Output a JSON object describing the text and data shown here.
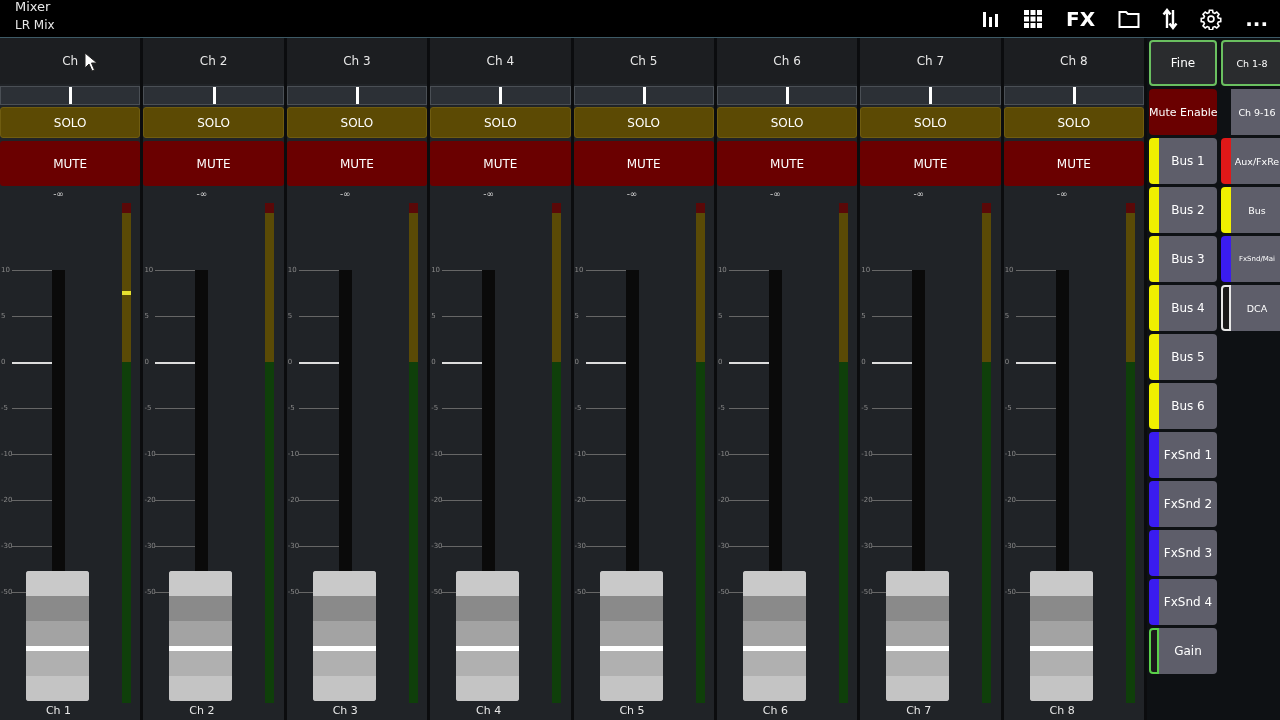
{
  "header": {
    "title": "Mixer",
    "subtitle": "LR Mix",
    "tools": [
      {
        "kind": "bars"
      },
      {
        "kind": "grid"
      },
      {
        "kind": "text",
        "label": "FX"
      },
      {
        "kind": "folder"
      },
      {
        "kind": "arrows"
      },
      {
        "kind": "gear"
      },
      {
        "kind": "text",
        "label": "..."
      }
    ]
  },
  "channels": [
    {
      "name": "Ch",
      "pan": {
        "level": 0.5
      },
      "solo": "SOLO",
      "mute": "MUTE",
      "gain_reading": "-∞",
      "fader": {
        "level": 0.12
      },
      "meter": {
        "level": 0.82
      },
      "label": "Ch 1",
      "scale": [
        "10",
        "5",
        "0",
        "-5",
        "-10",
        "-20",
        "-30",
        "-50"
      ]
    },
    {
      "name": "Ch 2",
      "pan": {
        "level": 0.5
      },
      "solo": "SOLO",
      "mute": "MUTE",
      "gain_reading": "-∞",
      "fader": {
        "level": 0.12
      },
      "label": "Ch 2",
      "scale": [
        "10",
        "5",
        "0",
        "-5",
        "-10",
        "-20",
        "-30",
        "-50"
      ]
    },
    {
      "name": "Ch 3",
      "pan": {
        "level": 0.5
      },
      "solo": "SOLO",
      "mute": "MUTE",
      "gain_reading": "-∞",
      "fader": {
        "level": 0.12
      },
      "label": "Ch 3",
      "scale": [
        "10",
        "5",
        "0",
        "-5",
        "-10",
        "-20",
        "-30",
        "-50"
      ]
    },
    {
      "name": "Ch 4",
      "pan": {
        "level": 0.5
      },
      "solo": "SOLO",
      "mute": "MUTE",
      "gain_reading": "-∞",
      "fader": {
        "level": 0.12
      },
      "label": "Ch 4",
      "scale": [
        "10",
        "5",
        "0",
        "-5",
        "-10",
        "-20",
        "-30",
        "-50"
      ]
    },
    {
      "name": "Ch 5",
      "pan": {
        "level": 0.5
      },
      "solo": "SOLO",
      "mute": "MUTE",
      "gain_reading": "-∞",
      "fader": {
        "level": 0.12
      },
      "label": "Ch 5",
      "scale": [
        "10",
        "5",
        "0",
        "-5",
        "-10",
        "-20",
        "-30",
        "-50"
      ]
    },
    {
      "name": "Ch 6",
      "pan": {
        "level": 0.5
      },
      "solo": "SOLO",
      "mute": "MUTE",
      "gain_reading": "-∞",
      "fader": {
        "level": 0.12
      },
      "label": "Ch 6",
      "scale": [
        "10",
        "5",
        "0",
        "-5",
        "-10",
        "-20",
        "-30",
        "-50"
      ]
    },
    {
      "name": "Ch 7",
      "pan": {
        "level": 0.5
      },
      "solo": "SOLO",
      "mute": "MUTE",
      "gain_reading": "-∞",
      "fader": {
        "level": 0.12
      },
      "label": "Ch 7",
      "scale": [
        "10",
        "5",
        "0",
        "-5",
        "-10",
        "-20",
        "-30",
        "-50"
      ]
    },
    {
      "name": "Ch 8",
      "pan": {
        "level": 0.5
      },
      "solo": "SOLO",
      "mute": "MUTE",
      "gain_reading": "-∞",
      "fader": {
        "level": 0.12
      },
      "label": "Ch 8",
      "scale": [
        "10",
        "5",
        "0",
        "-5",
        "-10",
        "-20",
        "-30",
        "-50"
      ]
    }
  ],
  "side_controls": [
    {
      "kind": "toggle",
      "label": "Fine",
      "selected": true
    },
    {
      "kind": "mute",
      "label": "Mute Enable"
    },
    {
      "kind": "stripe",
      "label": "Bus 1",
      "color": "#f0f000"
    },
    {
      "kind": "stripe",
      "label": "Bus 2",
      "color": "#f0f000"
    },
    {
      "kind": "stripe",
      "label": "Bus 3",
      "color": "#f0f000"
    },
    {
      "kind": "stripe",
      "label": "Bus 4",
      "color": "#f0f000"
    },
    {
      "kind": "stripe",
      "label": "Bus 5",
      "color": "#f0f000"
    },
    {
      "kind": "stripe",
      "label": "Bus 6",
      "color": "#f0f000"
    },
    {
      "kind": "stripe",
      "label": "FxSnd 1",
      "color": "#3a1cf0"
    },
    {
      "kind": "stripe",
      "label": "FxSnd 2",
      "color": "#3a1cf0"
    },
    {
      "kind": "stripe",
      "label": "FxSnd 3",
      "color": "#3a1cf0"
    },
    {
      "kind": "stripe",
      "label": "FxSnd 4",
      "color": "#3a1cf0"
    },
    {
      "kind": "outline",
      "label": "Gain",
      "color": "#5ad04a"
    }
  ],
  "layers": [
    {
      "kind": "toggle",
      "label": "Ch 1-8",
      "selected": true
    },
    {
      "kind": "plain",
      "label": "Ch 9-16"
    },
    {
      "kind": "stripe",
      "label": "Aux/FxRe",
      "color": "#e01818"
    },
    {
      "kind": "stripe",
      "label": "Bus",
      "color": "#f0f000"
    },
    {
      "kind": "stripe",
      "label": "FxSnd/Mai",
      "color": "#3a1cf0",
      "small": true
    },
    {
      "kind": "outline",
      "label": "DCA",
      "color": "#e8e8e8"
    }
  ]
}
